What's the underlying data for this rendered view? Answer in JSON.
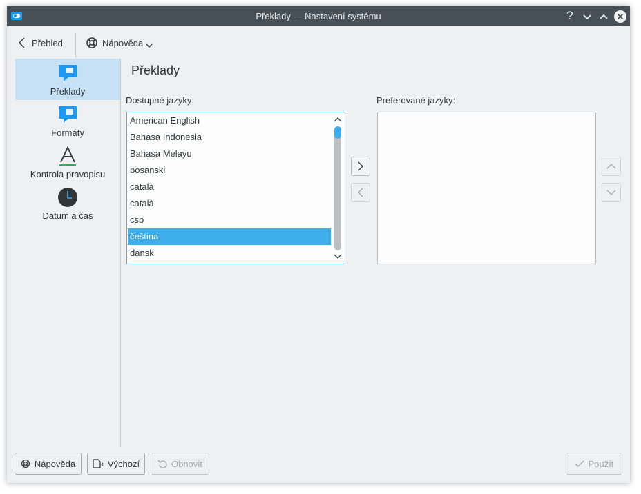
{
  "window": {
    "title": "Překlady  — Nastavení systému"
  },
  "titlebar": {
    "help_glyph": "?"
  },
  "toolbar": {
    "back_label": "Přehled",
    "help_label": "Nápověda"
  },
  "sidebar": {
    "items": [
      {
        "label": "Překlady",
        "icon": "speech-bubble-icon",
        "selected": true
      },
      {
        "label": "Formáty",
        "icon": "speech-bubble-icon",
        "selected": false
      },
      {
        "label": "Kontrola pravopisu",
        "icon": "spellcheck-icon",
        "selected": false
      },
      {
        "label": "Datum a čas",
        "icon": "clock-icon",
        "selected": false
      }
    ]
  },
  "main": {
    "title": "Překlady",
    "available_label": "Dostupné jazyky:",
    "preferred_label": "Preferované jazyky:",
    "available_languages": [
      "American English",
      "Bahasa Indonesia",
      "Bahasa Melayu",
      "bosanski",
      "català",
      "català",
      "csb",
      "čeština",
      "dansk"
    ],
    "selected_language": "čeština",
    "preferred_languages": []
  },
  "footer": {
    "help_label": "Nápověda",
    "defaults_label": "Výchozí",
    "reset_label": "Obnovit",
    "apply_label": "Použít"
  },
  "colors": {
    "accent": "#3daee9",
    "titlebar": "#475057",
    "window_bg": "#eff0f1",
    "sidebar_selected": "#c6e0f4"
  }
}
